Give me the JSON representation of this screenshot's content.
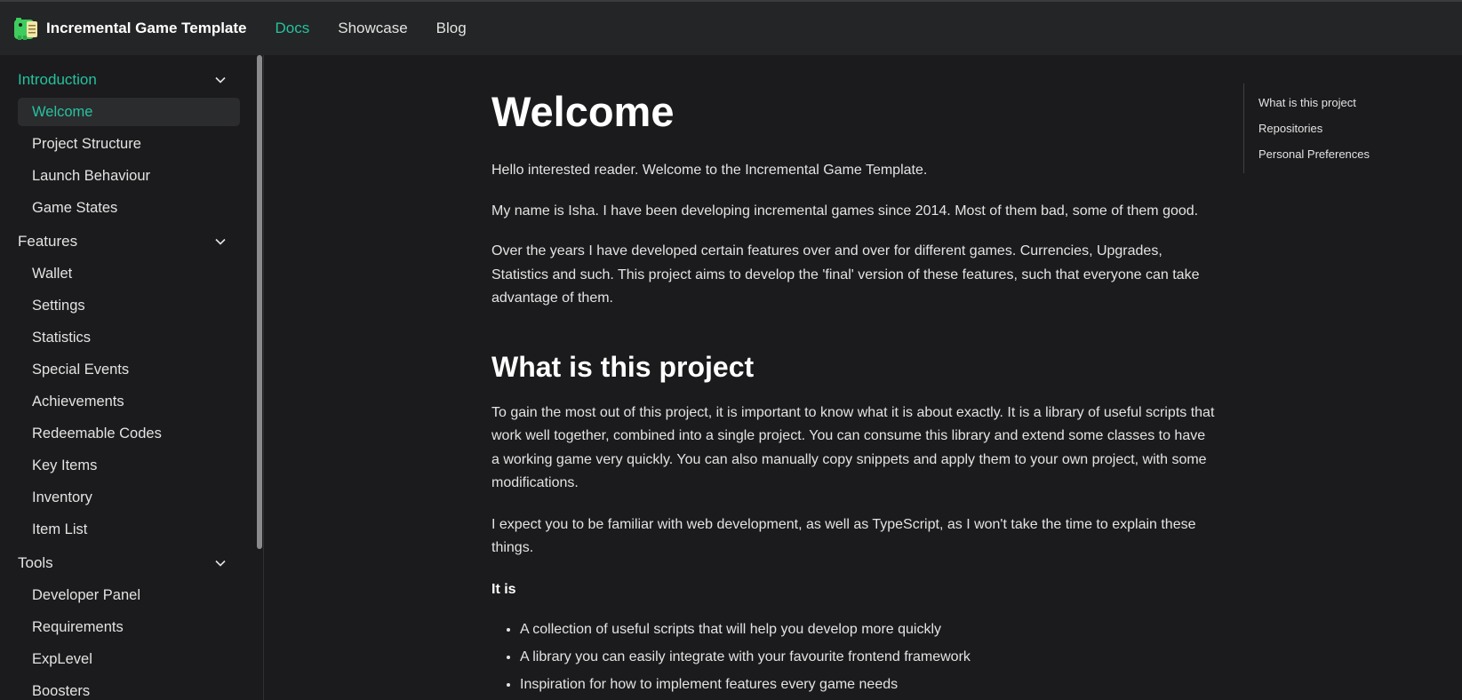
{
  "navbar": {
    "brand_title": "Incremental Game Template",
    "links": [
      {
        "label": "Docs",
        "active": true
      },
      {
        "label": "Showcase",
        "active": false
      },
      {
        "label": "Blog",
        "active": false
      }
    ]
  },
  "sidebar": {
    "categories": [
      {
        "label": "Introduction",
        "active": true,
        "items": [
          "Welcome",
          "Project Structure",
          "Launch Behaviour",
          "Game States"
        ]
      },
      {
        "label": "Features",
        "active": false,
        "items": [
          "Wallet",
          "Settings",
          "Statistics",
          "Special Events",
          "Achievements",
          "Redeemable Codes",
          "Key Items",
          "Inventory",
          "Item List"
        ]
      },
      {
        "label": "Tools",
        "active": false,
        "items": [
          "Developer Panel",
          "Requirements",
          "ExpLevel",
          "Boosters"
        ]
      }
    ],
    "active_item": "Welcome"
  },
  "main": {
    "title": "Welcome",
    "intro": [
      "Hello interested reader. Welcome to the Incremental Game Template.",
      "My name is Isha. I have been developing incremental games since 2014. Most of them bad, some of them good.",
      "Over the years I have developed certain features over and over for different games. Currencies, Upgrades, Statistics and such. This project aims to develop the 'final' version of these features, such that everyone can take advantage of them."
    ],
    "section_heading": "What is this project",
    "section_paragraphs": [
      "To gain the most out of this project, it is important to know what it is about exactly. It is a library of useful scripts that work well together, combined into a single project. You can consume this library and extend some classes to have a working game very quickly. You can also manually copy snippets and apply them to your own project, with some modifications.",
      "I expect you to be familiar with web development, as well as TypeScript, as I won't take the time to explain these things."
    ],
    "it_is_label": "It is",
    "bullets": [
      "A collection of useful scripts that will help you develop more quickly",
      "A library you can easily integrate with your favourite frontend framework",
      "Inspiration for how to implement features every game needs"
    ]
  },
  "toc": {
    "links": [
      "What is this project",
      "Repositories",
      "Personal Preferences"
    ]
  },
  "colors": {
    "accent": "#25c2a0",
    "background": "#1b1b1d",
    "navbar": "#242526",
    "active_item_bg": "#2b2c2e"
  },
  "icons": {
    "logo": "dino-logo-icon",
    "collapse": "chevron-down-icon"
  }
}
